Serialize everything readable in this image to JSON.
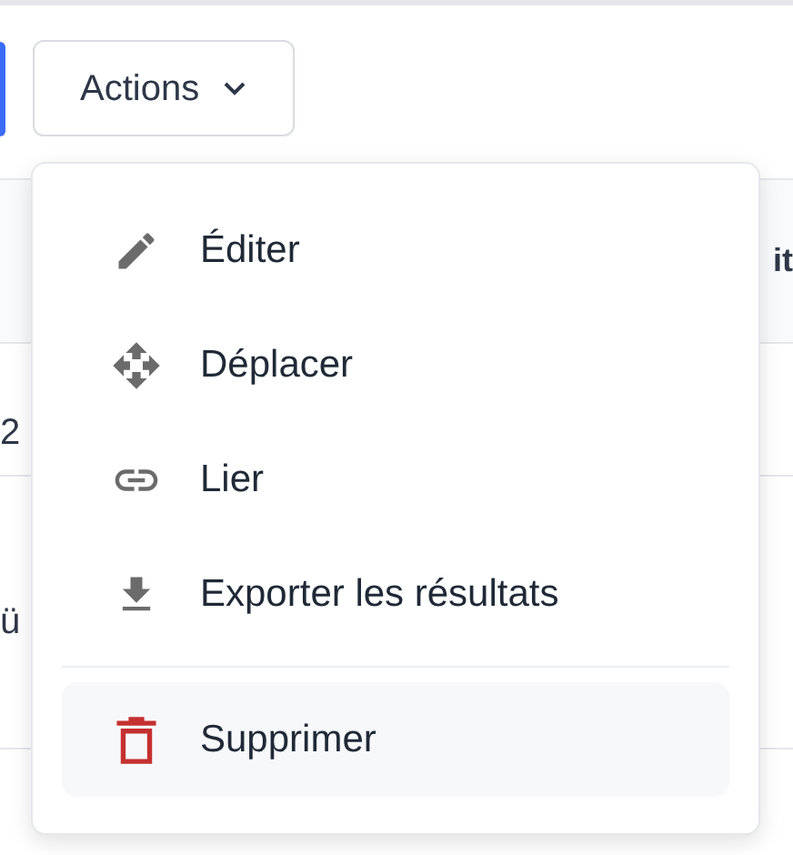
{
  "toolbar": {
    "actions_button": {
      "label": "Actions",
      "expanded": true
    }
  },
  "table": {
    "header": {
      "column_3": "it"
    },
    "rows": [
      {
        "column_1": "2"
      },
      {
        "column_1": "ü"
      }
    ]
  },
  "menu": {
    "items": [
      {
        "kind": "edit",
        "label": "Éditer",
        "highlighted": false,
        "danger": false
      },
      {
        "kind": "move",
        "label": "Déplacer",
        "highlighted": false,
        "danger": false
      },
      {
        "kind": "link",
        "label": "Lier",
        "highlighted": false,
        "danger": false
      },
      {
        "kind": "export",
        "label": "Exporter les résultats",
        "highlighted": false,
        "danger": false
      },
      {
        "kind": "delete",
        "label": "Supprimer",
        "highlighted": true,
        "danger": true,
        "separator_before": true
      }
    ]
  }
}
